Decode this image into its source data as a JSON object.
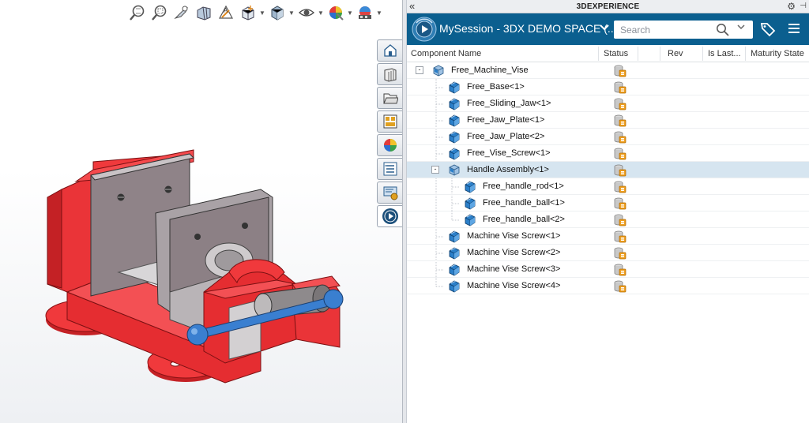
{
  "heads_up_toolbar": {
    "tools": [
      "zoom-to-fit-icon",
      "zoom-to-area-icon",
      "previous-view-icon",
      "section-view-icon",
      "dynamic-annotation-icon",
      "view-orientation-icon",
      "display-style-icon",
      "hide-show-icon",
      "edit-appearance-icon",
      "apply-scene-icon"
    ]
  },
  "task_pane": {
    "tabs": [
      "home-icon",
      "design-library-icon",
      "file-explorer-icon",
      "view-palette-icon",
      "appearances-icon",
      "custom-properties-icon",
      "solidworks-forum-icon",
      "3dexperience-icon"
    ]
  },
  "panel": {
    "title": "3DEXPERIENCE",
    "collapse_glyph": "«",
    "session_name": "MySession - 3DX DEMO SPACE (...",
    "search_placeholder": "Search"
  },
  "columns": {
    "component_name": "Component Name",
    "status": "Status",
    "rev": "Rev",
    "is_last": "Is Last...",
    "maturity_state": "Maturity State"
  },
  "tree": [
    {
      "label": "Free_Machine_Vise",
      "level": 0,
      "type": "assembly",
      "expander": "-"
    },
    {
      "label": "Free_Base<1>",
      "level": 1,
      "type": "part"
    },
    {
      "label": "Free_Sliding_Jaw<1>",
      "level": 1,
      "type": "part"
    },
    {
      "label": "Free_Jaw_Plate<1>",
      "level": 1,
      "type": "part"
    },
    {
      "label": "Free_Jaw_Plate<2>",
      "level": 1,
      "type": "part"
    },
    {
      "label": "Free_Vise_Screw<1>",
      "level": 1,
      "type": "part"
    },
    {
      "label": "Handle Assembly<1>",
      "level": 1,
      "type": "assembly",
      "expander": "-",
      "selected": true
    },
    {
      "label": "Free_handle_rod<1>",
      "level": 2,
      "type": "part"
    },
    {
      "label": "Free_handle_ball<1>",
      "level": 2,
      "type": "part"
    },
    {
      "label": "Free_handle_ball<2>",
      "level": 2,
      "type": "part"
    },
    {
      "label": "Machine Vise Screw<1>",
      "level": 1,
      "type": "part"
    },
    {
      "label": "Machine Vise Screw<2>",
      "level": 1,
      "type": "part"
    },
    {
      "label": "Machine Vise Screw<3>",
      "level": 1,
      "type": "part"
    },
    {
      "label": "Machine Vise Screw<4>",
      "level": 1,
      "type": "part"
    }
  ],
  "colors": {
    "session_bar": "#0b5f8f",
    "selected_row": "#d6e5f0",
    "model_red": "#f0393c",
    "model_blue": "#3a7fd0",
    "model_gray": "#9aa0a8"
  }
}
